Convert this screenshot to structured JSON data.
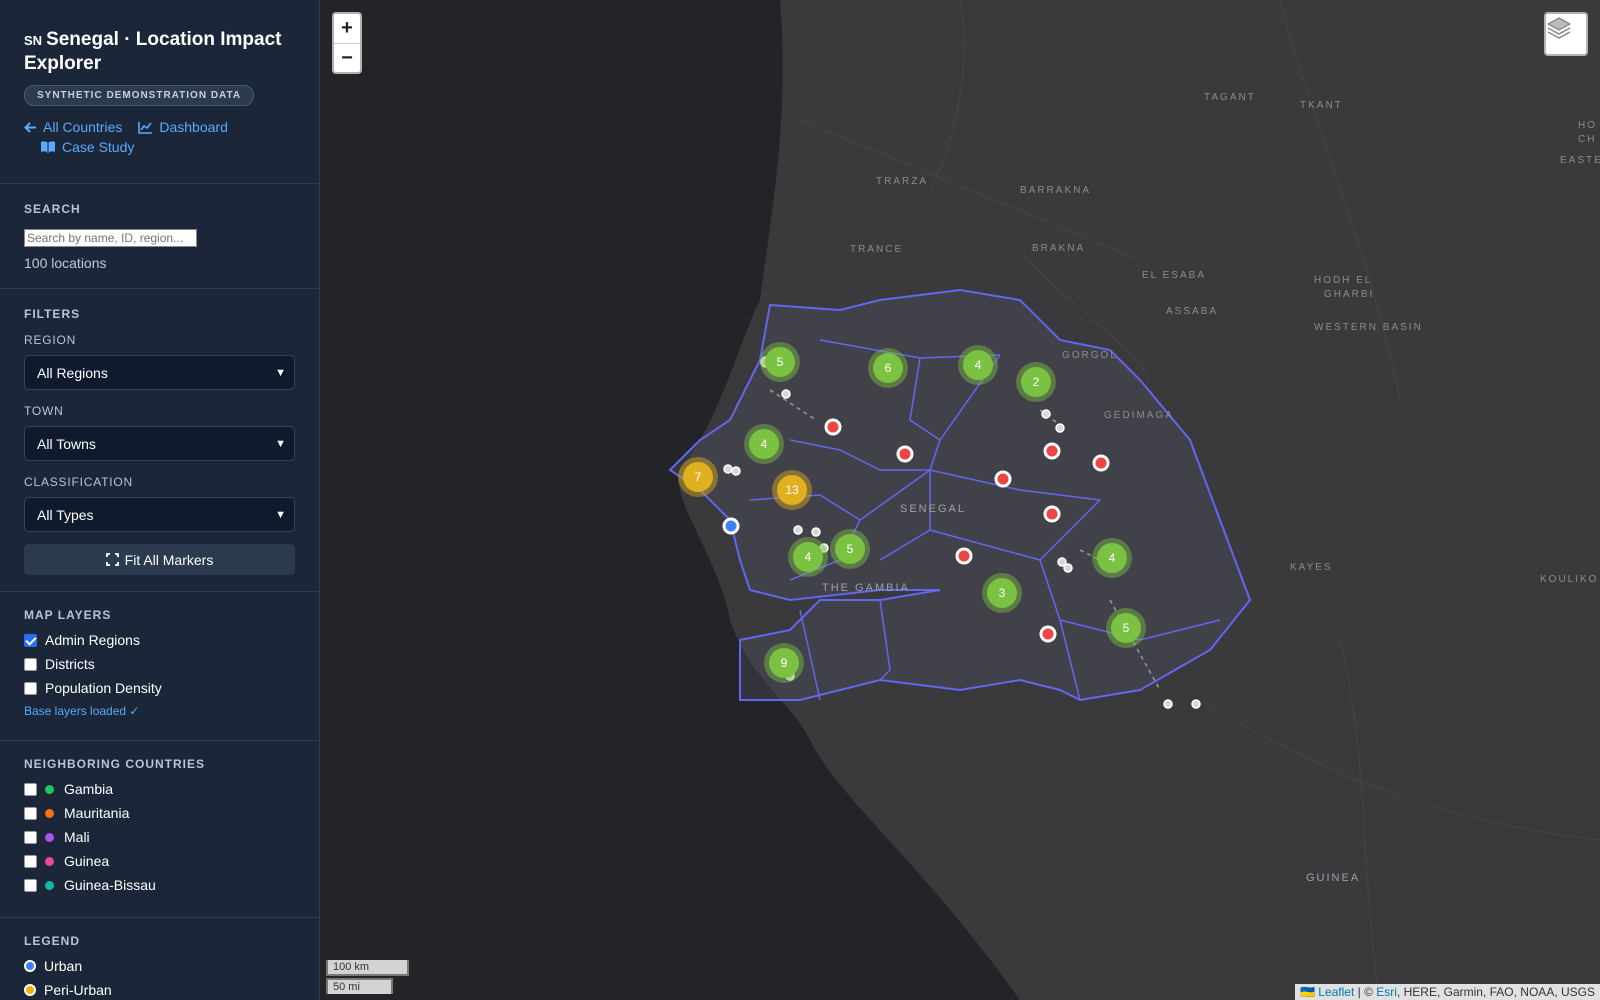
{
  "app": {
    "flag": "SN",
    "title": "Senegal · Location Impact Explorer",
    "badge": "SYNTHETIC DEMONSTRATION DATA",
    "links": {
      "all_countries": "All Countries",
      "dashboard": "Dashboard",
      "case_study": "Case Study"
    }
  },
  "search": {
    "heading": "SEARCH",
    "placeholder": "Search by name, ID, region...",
    "value": "",
    "count_text": "100 locations"
  },
  "filters": {
    "heading": "FILTERS",
    "region": {
      "label": "REGION",
      "selected": "All Regions"
    },
    "town": {
      "label": "TOWN",
      "selected": "All Towns"
    },
    "classification": {
      "label": "CLASSIFICATION",
      "selected": "All Types"
    },
    "fit_button": "Fit All Markers"
  },
  "map_layers": {
    "heading": "MAP LAYERS",
    "items": [
      {
        "label": "Admin Regions",
        "checked": true
      },
      {
        "label": "Districts",
        "checked": false
      },
      {
        "label": "Population Density",
        "checked": false
      }
    ],
    "status": "Base layers loaded ✓"
  },
  "neighbors": {
    "heading": "NEIGHBORING COUNTRIES",
    "items": [
      {
        "label": "Gambia",
        "color": "#22c55e",
        "checked": false
      },
      {
        "label": "Mauritania",
        "color": "#f97316",
        "checked": false
      },
      {
        "label": "Mali",
        "color": "#a855f7",
        "checked": false
      },
      {
        "label": "Guinea",
        "color": "#ec4899",
        "checked": false
      },
      {
        "label": "Guinea-Bissau",
        "color": "#14b8a6",
        "checked": false
      }
    ]
  },
  "legend": {
    "heading": "LEGEND",
    "items": [
      {
        "label": "Urban",
        "color": "#3b82f6"
      },
      {
        "label": "Peri-Urban",
        "color": "#eab308"
      }
    ]
  },
  "map": {
    "zoom_in": "+",
    "zoom_out": "−",
    "scale_km": "100 km",
    "scale_mi": "50 mi",
    "attribution": {
      "flag": "🇺🇦",
      "leaflet": "Leaflet",
      "sep": " | © ",
      "esri": "Esri",
      "rest": ", HERE, Garmin, FAO, NOAA, USGS"
    },
    "place_labels": [
      "TAGANT",
      "TKANT",
      "HO",
      "CH",
      "EASTE",
      "TRARZA",
      "BARRAKNA",
      "TRANCE",
      "BRAKNA",
      "EL ESABA",
      "ASSABA",
      "HODH EL",
      "GHARBI",
      "WESTERN BASIN",
      "GORGOL",
      "GEDIMAGA",
      "SENEGAL",
      "THE GAMBIA",
      "KAYES",
      "KOULIKO",
      "GUINEA"
    ],
    "clusters": [
      "5",
      "6",
      "4",
      "2",
      "4",
      "13",
      "7",
      "5",
      "4",
      "4",
      "3",
      "5",
      "9"
    ],
    "colors": {
      "cluster_green": "#7cc242",
      "cluster_yellow": "#e0b020",
      "boundary": "#6366f1",
      "marker_red": "#ef4444",
      "marker_blue": "#3b82f6"
    }
  }
}
